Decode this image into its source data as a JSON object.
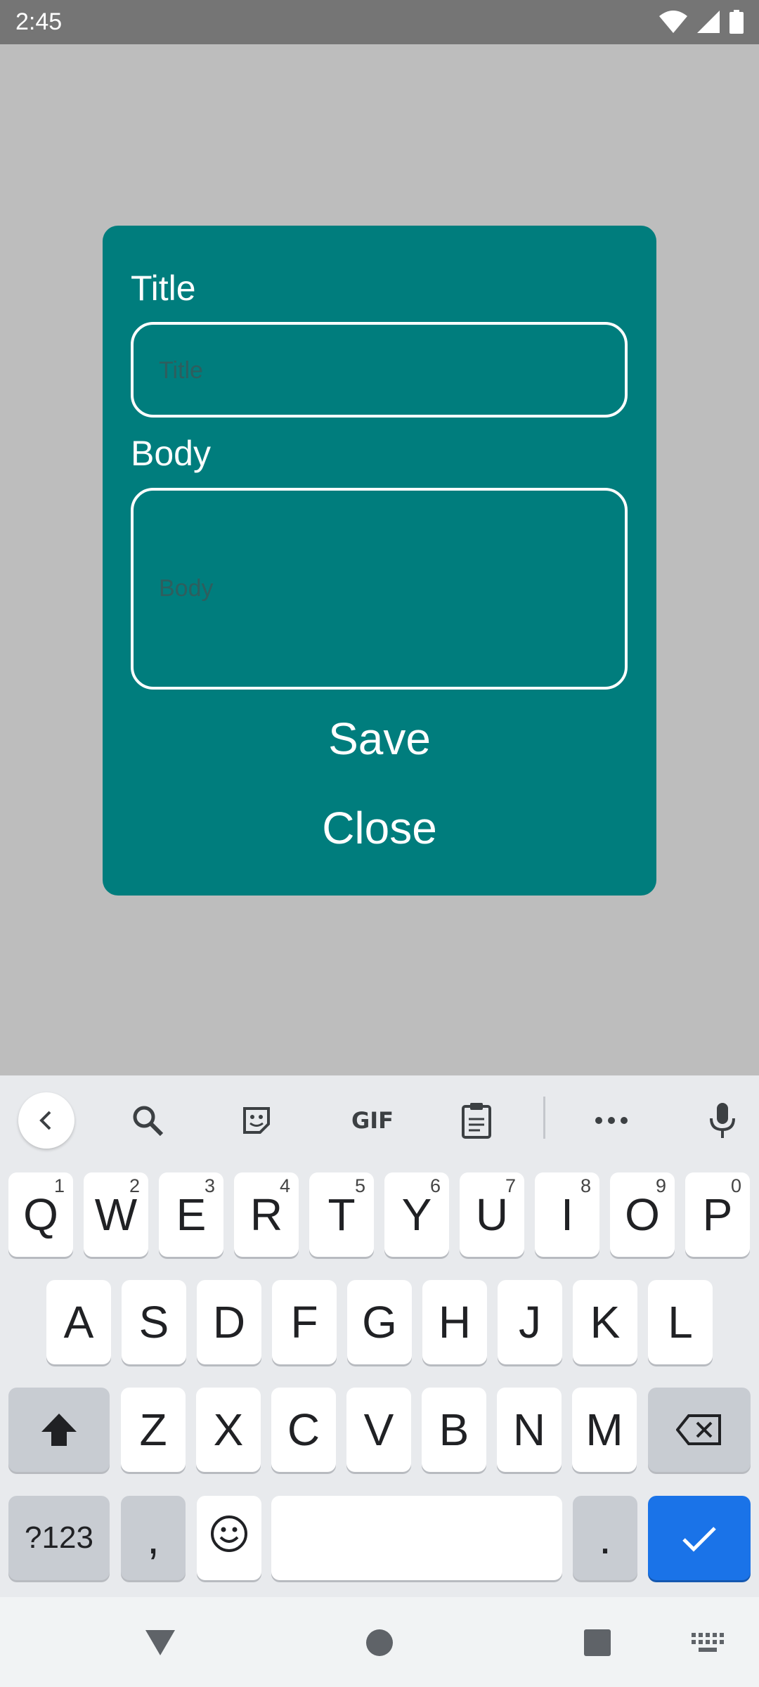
{
  "status_bar": {
    "time": "2:45",
    "icons": [
      "wifi-icon",
      "signal-icon",
      "battery-icon"
    ]
  },
  "dialog": {
    "title_label": "Title",
    "title_placeholder": "Title",
    "body_label": "Body",
    "body_placeholder": "Body",
    "save_label": "Save",
    "close_label": "Close",
    "background_color": "#007d7d"
  },
  "keyboard": {
    "toolbar_icons": [
      "chevron-left-icon",
      "search-icon",
      "sticker-icon",
      "gif-icon",
      "clipboard-icon",
      "more-icon",
      "mic-icon"
    ],
    "gif_label": "GIF",
    "row1": [
      {
        "label": "Q",
        "hint": "1"
      },
      {
        "label": "W",
        "hint": "2"
      },
      {
        "label": "E",
        "hint": "3"
      },
      {
        "label": "R",
        "hint": "4"
      },
      {
        "label": "T",
        "hint": "5"
      },
      {
        "label": "Y",
        "hint": "6"
      },
      {
        "label": "U",
        "hint": "7"
      },
      {
        "label": "I",
        "hint": "8"
      },
      {
        "label": "O",
        "hint": "9"
      },
      {
        "label": "P",
        "hint": "0"
      }
    ],
    "row2": [
      "A",
      "S",
      "D",
      "F",
      "G",
      "H",
      "J",
      "K",
      "L"
    ],
    "row3": [
      "Z",
      "X",
      "C",
      "V",
      "B",
      "N",
      "M"
    ],
    "symbols_label": "?123",
    "comma_label": ",",
    "period_label": ".",
    "accent_color": "#1a73e8"
  },
  "nav_bar": {
    "icons": [
      "back-icon",
      "home-icon",
      "recents-icon",
      "keyboard-switch-icon"
    ]
  }
}
